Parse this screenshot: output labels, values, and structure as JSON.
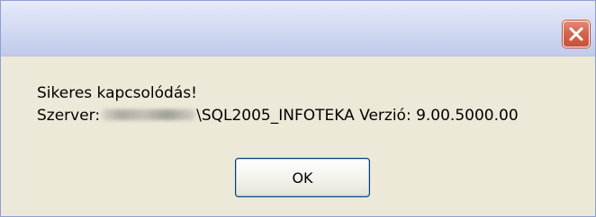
{
  "dialog": {
    "title": "",
    "close_icon": "close-icon",
    "message_line1": "Sikeres kapcsolódás!",
    "server_label": "Szerver:",
    "server_suffix": "\\SQL2005_INFOTEKA Verzió: 9.00.5000.00",
    "ok_label": "OK"
  },
  "colors": {
    "dialog_background": "#ece9d8",
    "close_button_red": "#d4664f",
    "ok_button_border": "#003c74"
  }
}
